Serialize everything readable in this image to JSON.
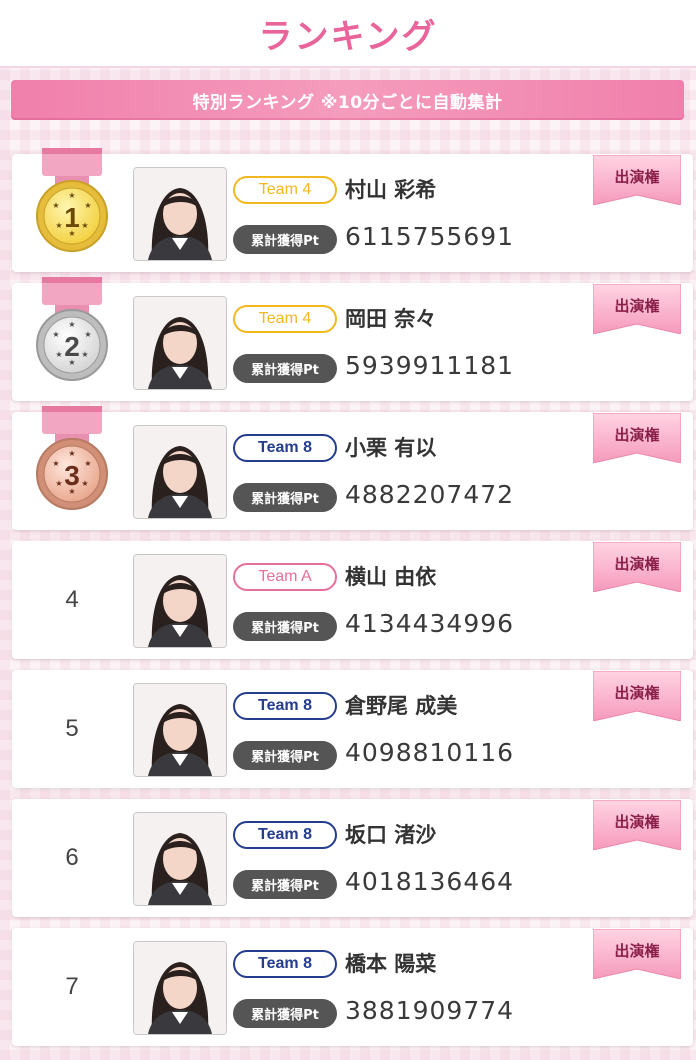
{
  "header": {
    "title": "ランキング"
  },
  "subbar": {
    "text": "特別ランキング ※10分ごとに自動集計"
  },
  "colors": {
    "accent": "#e8649a",
    "team4": "#f1b81f",
    "teamA": "#e86f9b",
    "team8": "#253d8f",
    "pt_label_bg": "#555555"
  },
  "pt_label": "累計獲得Pt",
  "ticket_label": "出演権",
  "rankings": [
    {
      "rank": "1",
      "medal": "gold",
      "team": "Team 4",
      "team_key": "team4",
      "name": "村山 彩希",
      "points": "6115755691",
      "photo_icon": "member-photo-icon"
    },
    {
      "rank": "2",
      "medal": "silver",
      "team": "Team 4",
      "team_key": "team4",
      "name": "岡田 奈々",
      "points": "5939911181",
      "photo_icon": "member-photo-icon"
    },
    {
      "rank": "3",
      "medal": "bronze",
      "team": "Team 8",
      "team_key": "team8",
      "name": "小栗 有以",
      "points": "4882207472",
      "photo_icon": "member-photo-icon"
    },
    {
      "rank": "4",
      "medal": "",
      "team": "Team A",
      "team_key": "teamA",
      "name": "横山 由依",
      "points": "4134434996",
      "photo_icon": "member-photo-icon"
    },
    {
      "rank": "5",
      "medal": "",
      "team": "Team 8",
      "team_key": "team8",
      "name": "倉野尾 成美",
      "points": "4098810116",
      "photo_icon": "member-photo-icon"
    },
    {
      "rank": "6",
      "medal": "",
      "team": "Team 8",
      "team_key": "team8",
      "name": "坂口 渚沙",
      "points": "4018136464",
      "photo_icon": "member-photo-icon"
    },
    {
      "rank": "7",
      "medal": "",
      "team": "Team 8",
      "team_key": "team8",
      "name": "橋本 陽菜",
      "points": "3881909774",
      "photo_icon": "member-photo-icon"
    }
  ]
}
